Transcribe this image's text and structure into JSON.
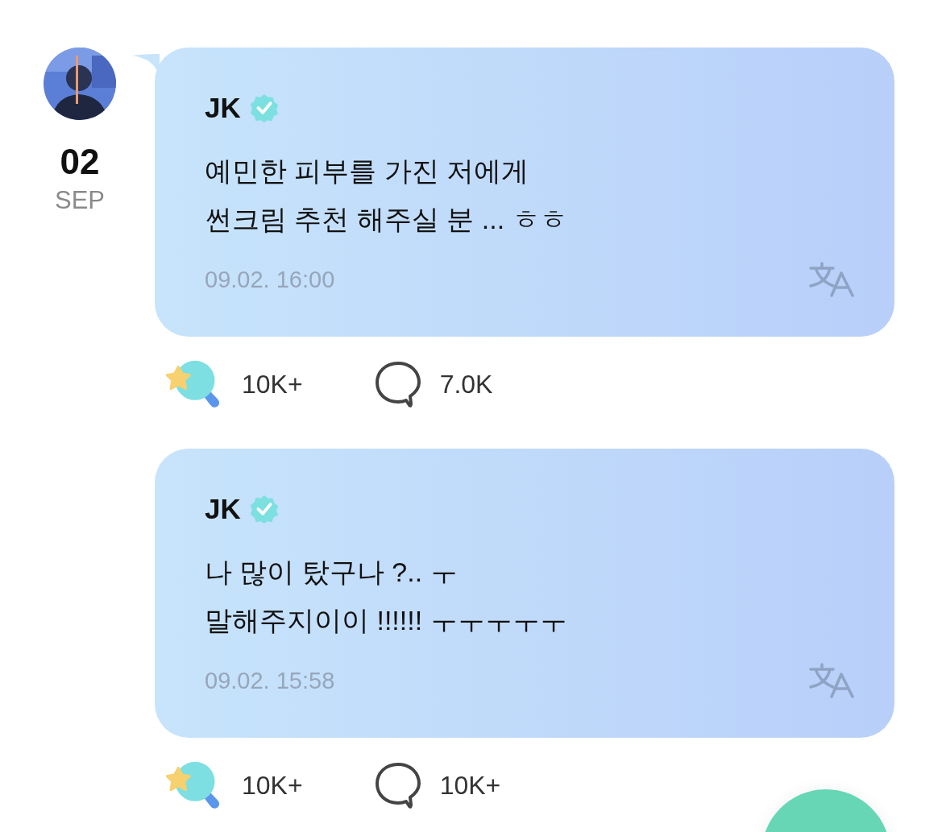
{
  "date": {
    "day": "02",
    "month": "SEP"
  },
  "posts": [
    {
      "author": "JK",
      "verified": true,
      "lines": [
        "예민한 피부를 가진 저에게",
        "썬크림 추천 해주실 분 ... ㅎㅎ"
      ],
      "time": "09.02. 16:00",
      "likes": "10K+",
      "comments": "7.0K"
    },
    {
      "author": "JK",
      "verified": true,
      "lines": [
        "나 많이 탔구나 ?.. ㅜ",
        "말해주지이이 !!!!!! ㅜㅜㅜㅜㅜ"
      ],
      "time": "09.02. 15:58",
      "likes": "10K+",
      "comments": "10K+"
    }
  ]
}
